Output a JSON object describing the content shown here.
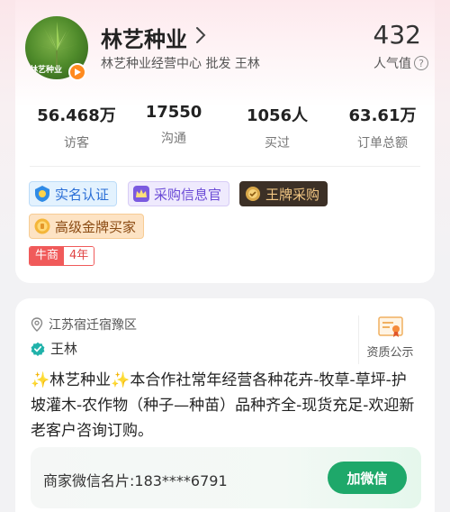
{
  "shop": {
    "name": "林艺种业",
    "avatar_text": "林艺种业",
    "subtitle": "林艺种业经营中心  批发  王林",
    "popularity_value": "432",
    "popularity_label": "人气值"
  },
  "stats": [
    {
      "value": "56.468万",
      "label": "访客"
    },
    {
      "value": "17550",
      "label": "沟通"
    },
    {
      "value": "1056人",
      "label": "买过"
    },
    {
      "value": "63.61万",
      "label": "订单总额"
    }
  ],
  "badges": {
    "real_name": "实名认证",
    "purchase_officer": "采购信息官",
    "ace_purchase": "王牌采购",
    "gold_buyer": "高级金牌买家",
    "niu_label": "牛商",
    "niu_years": "4年"
  },
  "info": {
    "location": "江苏宿迁宿豫区",
    "owner": "王林",
    "qualification": "资质公示",
    "description": "✨林艺种业✨本合作社常年经营各种花卉-牧草-草坪-护坡灌木-农作物（种子—种苗）品种齐全-现货充足-欢迎新老客户咨询订购。"
  },
  "wechat": {
    "card_text": "商家微信名片:183****6791",
    "button": "加微信"
  },
  "colors": {
    "accent_green": "#1ea86a",
    "niu_red": "#f05a5a",
    "verified_teal": "#20b2aa"
  }
}
